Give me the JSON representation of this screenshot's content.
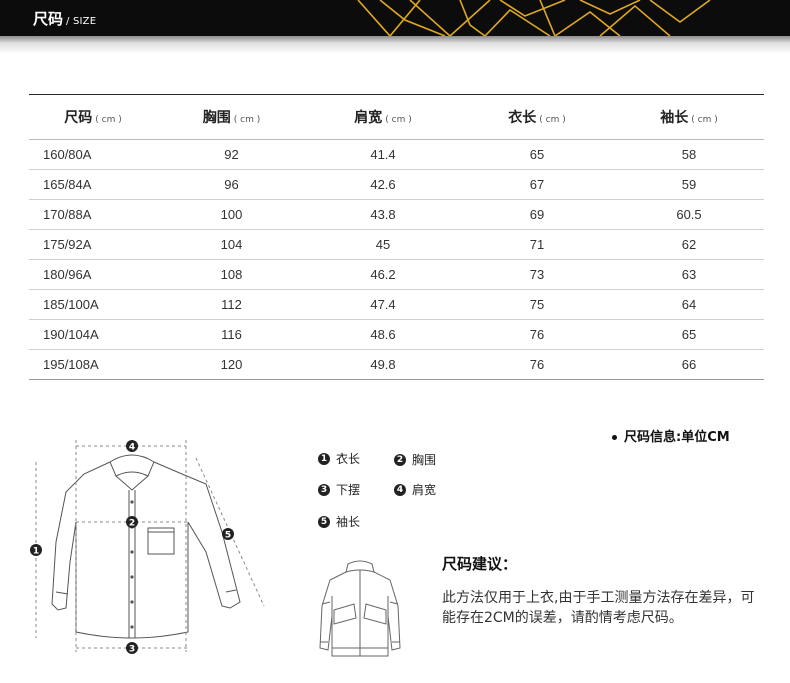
{
  "header": {
    "title_zh": "尺码",
    "title_en": "/ SIZE"
  },
  "table": {
    "headers": [
      {
        "label": "尺码",
        "unit": "( cm )"
      },
      {
        "label": "胸围",
        "unit": "( cm )"
      },
      {
        "label": "肩宽",
        "unit": "( cm )"
      },
      {
        "label": "衣长",
        "unit": "( cm )"
      },
      {
        "label": "袖长",
        "unit": "( cm )"
      }
    ],
    "rows": [
      [
        "160/80A",
        "92",
        "41.4",
        "65",
        "58"
      ],
      [
        "165/84A",
        "96",
        "42.6",
        "67",
        "59"
      ],
      [
        "170/88A",
        "100",
        "43.8",
        "69",
        "60.5"
      ],
      [
        "175/92A",
        "104",
        "45",
        "71",
        "62"
      ],
      [
        "180/96A",
        "108",
        "46.2",
        "73",
        "63"
      ],
      [
        "185/100A",
        "112",
        "47.4",
        "75",
        "64"
      ],
      [
        "190/104A",
        "116",
        "48.6",
        "76",
        "65"
      ],
      [
        "195/108A",
        "120",
        "49.8",
        "76",
        "66"
      ]
    ]
  },
  "unit_note": "尺码信息:单位CM",
  "diagram_markers": [
    "1",
    "2",
    "3",
    "4",
    "5"
  ],
  "legend": [
    {
      "num": "1",
      "label": "衣长"
    },
    {
      "num": "2",
      "label": "胸围"
    },
    {
      "num": "3",
      "label": "下摆"
    },
    {
      "num": "4",
      "label": "肩宽"
    },
    {
      "num": "5",
      "label": "袖长"
    }
  ],
  "advice": {
    "title": "尺码建议：",
    "text": "此方法仅用于上衣,由于手工测量方法存在差异，可能存在2CM的误差，请酌情考虑尺码。"
  },
  "colors": {
    "header_bg": "#0c0c0c",
    "accent_gold": "#e0a820",
    "text_dark": "#222222"
  }
}
